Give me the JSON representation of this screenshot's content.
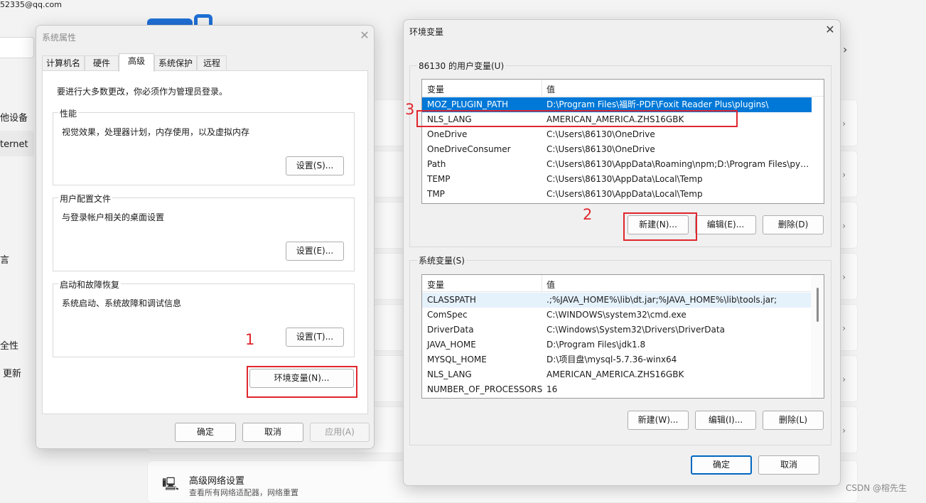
{
  "background": {
    "email": "52335@qq.com",
    "side_items": [
      "他设备",
      "ternet",
      "言",
      "全性",
      "更新"
    ],
    "network_card": {
      "title": "高级网络设置",
      "subtitle": "查看所有网络适配器，网络重置"
    },
    "watermark": "CSDN @榕先生"
  },
  "sysprops": {
    "title": "系统属性",
    "tabs": [
      "计算机名",
      "硬件",
      "高级",
      "系统保护",
      "远程"
    ],
    "admin_note": "要进行大多数更改，你必须作为管理员登录。",
    "performance": {
      "title": "性能",
      "desc": "视觉效果，处理器计划，内存使用，以及虚拟内存",
      "button": "设置(S)..."
    },
    "profile": {
      "title": "用户配置文件",
      "desc": "与登录帐户相关的桌面设置",
      "button": "设置(E)..."
    },
    "startup": {
      "title": "启动和故障恢复",
      "desc": "系统启动、系统故障和调试信息",
      "button": "设置(T)..."
    },
    "env_button": "环境变量(N)...",
    "ok": "确定",
    "cancel": "取消",
    "apply": "应用(A)"
  },
  "envvars": {
    "title": "环境变量",
    "user_group": "86130 的用户变量(U)",
    "col_var": "变量",
    "col_val": "值",
    "user_vars": [
      {
        "name": "MOZ_PLUGIN_PATH",
        "value": "D:\\Program Files\\福昕-PDF\\Foxit Reader Plus\\plugins\\"
      },
      {
        "name": "NLS_LANG",
        "value": "AMERICAN_AMERICA.ZHS16GBK"
      },
      {
        "name": "OneDrive",
        "value": "C:\\Users\\86130\\OneDrive"
      },
      {
        "name": "OneDriveConsumer",
        "value": "C:\\Users\\86130\\OneDrive"
      },
      {
        "name": "Path",
        "value": "C:\\Users\\86130\\AppData\\Roaming\\npm;D:\\Program Files\\pyt..."
      },
      {
        "name": "TEMP",
        "value": "C:\\Users\\86130\\AppData\\Local\\Temp"
      },
      {
        "name": "TMP",
        "value": "C:\\Users\\86130\\AppData\\Local\\Temp"
      }
    ],
    "user_buttons": {
      "new": "新建(N)...",
      "edit": "编辑(E)...",
      "delete": "删除(D)"
    },
    "sys_group": "系统变量(S)",
    "sys_vars": [
      {
        "name": "CLASSPATH",
        "value": ".;%JAVA_HOME%\\lib\\dt.jar;%JAVA_HOME%\\lib\\tools.jar;"
      },
      {
        "name": "ComSpec",
        "value": "C:\\WINDOWS\\system32\\cmd.exe"
      },
      {
        "name": "DriverData",
        "value": "C:\\Windows\\System32\\Drivers\\DriverData"
      },
      {
        "name": "JAVA_HOME",
        "value": "D:\\Program Files\\jdk1.8"
      },
      {
        "name": "MYSQL_HOME",
        "value": "D:\\项目盘\\mysql-5.7.36-winx64"
      },
      {
        "name": "NLS_LANG",
        "value": "AMERICAN_AMERICA.ZHS16GBK"
      },
      {
        "name": "NUMBER_OF_PROCESSORS",
        "value": "16"
      }
    ],
    "sys_buttons": {
      "new": "新建(W)...",
      "edit": "编辑(I)...",
      "delete": "删除(L)"
    },
    "ok": "确定",
    "cancel": "取消"
  },
  "annotations": [
    "1",
    "2",
    "3"
  ],
  "colors": {
    "highlight": "#e0262d",
    "selection": "#0078d7",
    "accent": "#0067c0"
  }
}
